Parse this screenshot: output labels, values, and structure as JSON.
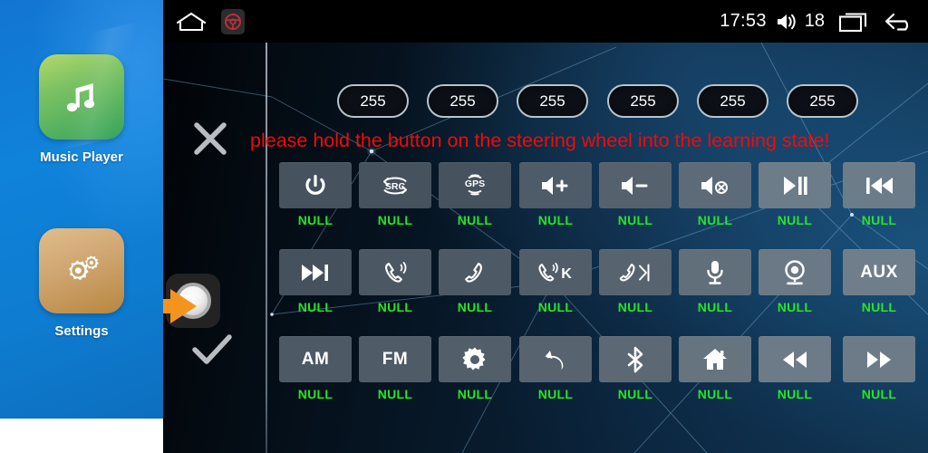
{
  "sidebar": {
    "apps": [
      {
        "icon": "music-note-icon",
        "label": "Music Player"
      },
      {
        "icon": "gears-icon",
        "label": "Settings"
      }
    ]
  },
  "statusbar": {
    "home_icon": "home-outline-icon",
    "steering_icon": "steering-wheel-icon",
    "time": "17:53",
    "volume_icon": "volume-icon",
    "volume_level": "18",
    "recents_icon": "recent-apps-icon",
    "back_icon": "back-arrow-icon"
  },
  "rail": {
    "cancel_icon": "close-x-icon",
    "confirm_icon": "check-icon",
    "knob_icon": "round-knob-button",
    "pointer_icon": "orange-arrow-pointer-icon"
  },
  "values": {
    "pills": [
      "255",
      "255",
      "255",
      "255",
      "255",
      "255"
    ]
  },
  "notice": {
    "text": "please hold the button on the steering wheel into the learning state!",
    "color": "#f00a0a"
  },
  "grid": {
    "label_color": "#25e625",
    "rows": [
      [
        {
          "icon": "power-icon",
          "text": "",
          "label": "NULL"
        },
        {
          "icon": "src-icon",
          "text": "",
          "label": "NULL"
        },
        {
          "icon": "gps-icon",
          "text": "",
          "label": "NULL"
        },
        {
          "icon": "volume-up-icon",
          "text": "",
          "label": "NULL"
        },
        {
          "icon": "volume-down-icon",
          "text": "",
          "label": "NULL"
        },
        {
          "icon": "mute-icon",
          "text": "",
          "label": "NULL"
        },
        {
          "icon": "play-pause-icon",
          "text": "",
          "label": "NULL"
        },
        {
          "icon": "previous-track-icon",
          "text": "",
          "label": "NULL"
        }
      ],
      [
        {
          "icon": "next-track-icon",
          "text": "",
          "label": "NULL"
        },
        {
          "icon": "call-answer-icon",
          "text": "",
          "label": "NULL"
        },
        {
          "icon": "call-hangup-icon",
          "text": "",
          "label": "NULL"
        },
        {
          "icon": "call-answer-k-icon",
          "text": "",
          "label": "NULL"
        },
        {
          "icon": "call-hangup-skip-icon",
          "text": "",
          "label": "NULL"
        },
        {
          "icon": "microphone-icon",
          "text": "",
          "label": "NULL"
        },
        {
          "icon": "camera-icon",
          "text": "",
          "label": "NULL"
        },
        {
          "icon": "",
          "text": "AUX",
          "label": "NULL"
        }
      ],
      [
        {
          "icon": "",
          "text": "AM",
          "label": "NULL"
        },
        {
          "icon": "",
          "text": "FM",
          "label": "NULL"
        },
        {
          "icon": "brightness-icon",
          "text": "",
          "label": "NULL"
        },
        {
          "icon": "back-curved-arrow-icon",
          "text": "",
          "label": "NULL"
        },
        {
          "icon": "bluetooth-icon",
          "text": "",
          "label": "NULL"
        },
        {
          "icon": "home-filled-icon",
          "text": "",
          "label": "NULL"
        },
        {
          "icon": "rewind-icon",
          "text": "",
          "label": "NULL"
        },
        {
          "icon": "fast-forward-icon",
          "text": "",
          "label": "NULL"
        }
      ]
    ]
  }
}
